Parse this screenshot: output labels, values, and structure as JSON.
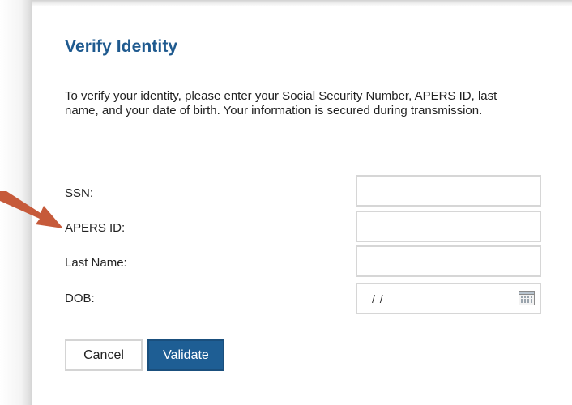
{
  "form": {
    "title": "Verify Identity",
    "intro": "To verify your identity, please enter your Social Security Number, APERS ID, last name, and your date of birth. Your information is secured during transmission.",
    "fields": {
      "ssn": {
        "label": "SSN:",
        "value": ""
      },
      "apers_id": {
        "label": "APERS ID:",
        "value": ""
      },
      "last_name": {
        "label": "Last Name:",
        "value": ""
      },
      "dob": {
        "label": "DOB:",
        "value": "/ /"
      }
    },
    "buttons": {
      "cancel": "Cancel",
      "validate": "Validate"
    }
  },
  "icons": {
    "calendar": "calendar-icon",
    "annotation": "arrow-icon"
  },
  "colors": {
    "title": "#1f5a8f",
    "validate_button": "#1e5e94",
    "arrow": "#c65a3a"
  }
}
